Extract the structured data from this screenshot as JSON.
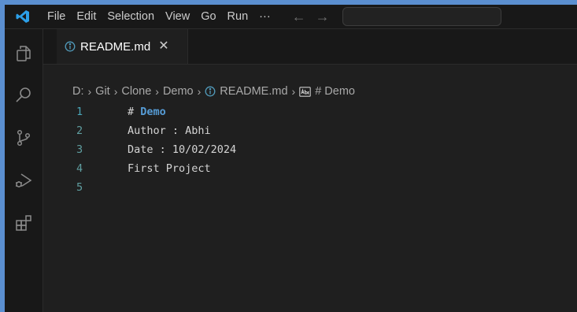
{
  "menu": [
    "File",
    "Edit",
    "Selection",
    "View",
    "Go",
    "Run",
    "···"
  ],
  "nav": {
    "back": "←",
    "forward": "→"
  },
  "tab": {
    "label": "README.md",
    "close": "✕"
  },
  "breadcrumb": {
    "drive": "D:",
    "folder1": "Git",
    "folder2": "Clone",
    "folder3": "Demo",
    "file": "README.md",
    "symbol": "# Demo",
    "separator": "›"
  },
  "editor": {
    "lines": [
      {
        "number": "1",
        "hash": "# ",
        "text": "Demo"
      },
      {
        "number": "2",
        "text": "Author : Abhi"
      },
      {
        "number": "3",
        "text": "Date : 10/02/2024"
      },
      {
        "number": "4",
        "text": "First Project"
      },
      {
        "number": "5",
        "text": ""
      }
    ]
  },
  "icons": {
    "logo": "vscode-logo-icon",
    "explorer": "explorer-icon",
    "search": "search-icon",
    "source_control": "source-control-icon",
    "run_debug": "run-debug-icon",
    "extensions": "extensions-icon"
  },
  "colors": {
    "accent": "#007acc",
    "heading": "#569cd6",
    "line_number": "#5f9ea0",
    "frame": "#5b8fd0"
  }
}
